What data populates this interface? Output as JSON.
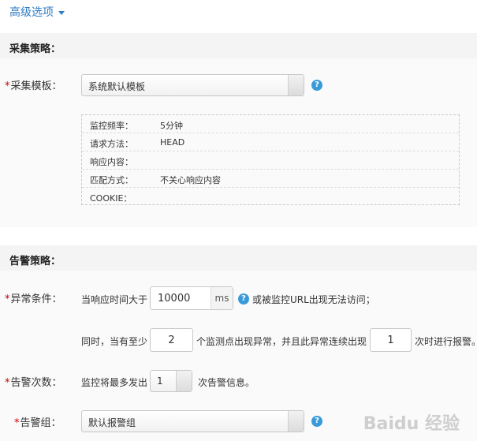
{
  "advanced": {
    "label": "高级选项"
  },
  "collect": {
    "section_title": "采集策略：",
    "template_label": "采集模板：",
    "template_value": "系统默认模板",
    "info_rows": [
      {
        "key": "监控频率：",
        "value": "5分钟"
      },
      {
        "key": "请求方法：",
        "value": "HEAD"
      },
      {
        "key": "响应内容：",
        "value": ""
      },
      {
        "key": "匹配方式：",
        "value": "不关心响应内容"
      },
      {
        "key": "COOKIE：",
        "value": ""
      }
    ]
  },
  "alert": {
    "section_title": "告警策略：",
    "abnormal_label": "异常条件：",
    "cond1_prefix": "当响应时间大于",
    "response_time_value": "10000",
    "response_time_unit": "ms",
    "cond1_suffix": "或被监控URL出现无法访问；",
    "cond2_prefix": "同时，当有至少",
    "min_points_value": "2",
    "cond2_middle": "个监测点出现异常，并且此异常连续出现",
    "consecutive_value": "1",
    "cond2_suffix": "次时进行报警。",
    "count_label": "告警次数：",
    "count_prefix": "监控将最多发出",
    "count_value": "1",
    "count_suffix": "次告警信息。",
    "group_label": "告警组：",
    "group_value": "默认报警组"
  },
  "required_mark": "*",
  "help_glyph": "?",
  "watermark": "Baidu 经验"
}
